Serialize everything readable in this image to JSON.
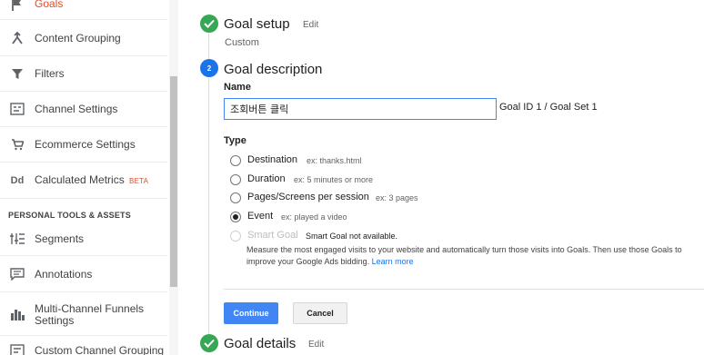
{
  "sidebar": {
    "items": [
      {
        "label": "Goals",
        "icon": "flag-icon"
      },
      {
        "label": "Content Grouping",
        "icon": "content-grouping-icon"
      },
      {
        "label": "Filters",
        "icon": "filter-icon"
      },
      {
        "label": "Channel Settings",
        "icon": "channel-settings-icon"
      },
      {
        "label": "Ecommerce Settings",
        "icon": "cart-icon"
      },
      {
        "label": "Calculated Metrics",
        "badge": "BETA",
        "icon": "dd-icon"
      }
    ],
    "section_title": "PERSONAL TOOLS & ASSETS",
    "tools": [
      {
        "label": "Segments",
        "icon": "segments-icon"
      },
      {
        "label": "Annotations",
        "icon": "annotation-icon"
      },
      {
        "label": "Multi-Channel Funnels Settings",
        "icon": "bar-chart-icon"
      },
      {
        "label": "Custom Channel Grouping",
        "icon": "custom-channel-icon"
      }
    ],
    "active_color": "#e04c2c"
  },
  "steps": {
    "setup": {
      "title": "Goal setup",
      "edit": "Edit",
      "value": "Custom"
    },
    "description": {
      "number": "2",
      "title": "Goal description"
    },
    "details": {
      "title": "Goal details",
      "edit": "Edit"
    }
  },
  "form": {
    "name_label": "Name",
    "name_value": "조회버튼 클릭",
    "goal_id": "Goal ID 1 / Goal Set 1",
    "type_label": "Type",
    "types": [
      {
        "label": "Destination",
        "example": "ex: thanks.html",
        "checked": false
      },
      {
        "label": "Duration",
        "example": "ex: 5 minutes or more",
        "checked": false
      },
      {
        "label": "Pages/Screens per session",
        "example": "ex: 3 pages",
        "checked": false
      },
      {
        "label": "Event",
        "example": "ex: played a video",
        "checked": true
      },
      {
        "label": "Smart Goal",
        "example": "Smart Goal not available.",
        "checked": false,
        "disabled": true
      }
    ],
    "smart_goal_desc": "Measure the most engaged visits to your website and automatically turn those visits into Goals. Then use those Goals to improve your Google Ads bidding.",
    "learn_more": "Learn more"
  },
  "buttons": {
    "continue": "Continue",
    "cancel": "Cancel"
  },
  "colors": {
    "accent": "#4285f4",
    "success": "#34a853",
    "step_active": "#1a73e8"
  }
}
